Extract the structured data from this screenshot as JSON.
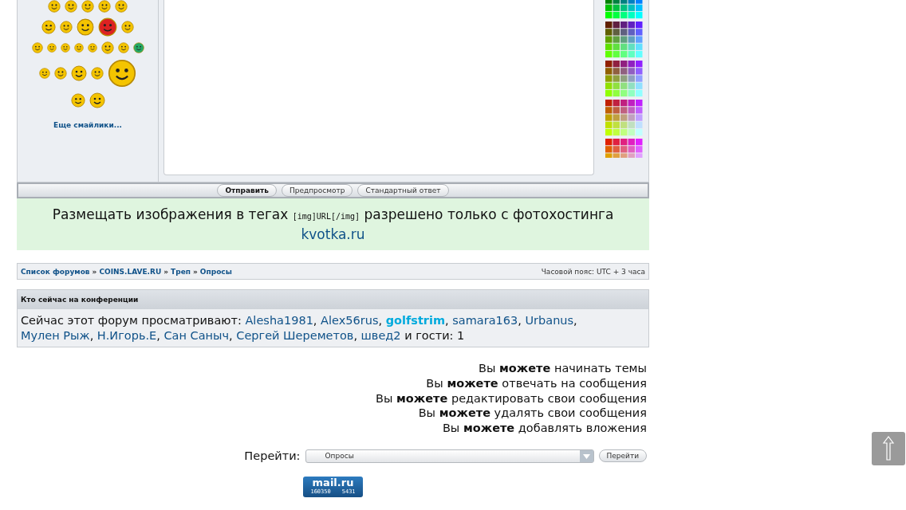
{
  "smilies": {
    "more_link": "Еще смайлики..."
  },
  "post_buttons": [
    {
      "label": "Отправить",
      "kind": "primary"
    },
    {
      "label": "Предпросмотр",
      "kind": "normal"
    },
    {
      "label": "Стандартный ответ",
      "kind": "normal"
    }
  ],
  "notice": {
    "text_before": "Размещать изображения в тегах ",
    "code": "[img]URL[/img]",
    "text_after": " разрешено только с фотохостинга",
    "link": "kvotka.ru"
  },
  "breadcrumb": [
    {
      "kind": "link",
      "label": "Список форумов"
    },
    {
      "kind": "separator",
      "label": "»"
    },
    {
      "kind": "link",
      "label": "COINS.LAVE.RU"
    },
    {
      "kind": "separator",
      "label": "»"
    },
    {
      "kind": "link",
      "label": "Треп"
    },
    {
      "kind": "separator",
      "label": "»"
    },
    {
      "kind": "link",
      "label": "Опросы"
    }
  ],
  "timezone": "Часовой пояс: UTC + 3 часа",
  "online": {
    "title": "Кто сейчас на конференции",
    "intro": "Сейчас этот форум просматривают: ",
    "users": [
      {
        "name": "Alesha1981",
        "color": "#105289",
        "bold": false
      },
      {
        "name": "Alex56rus",
        "color": "#105289",
        "bold": false
      },
      {
        "name": "golfstrim",
        "color": "#00aadd",
        "bold": true
      },
      {
        "name": "samara163",
        "color": "#105289",
        "bold": false
      },
      {
        "name": "Urbanus",
        "color": "#105289",
        "bold": false
      },
      {
        "name": "Мулен Рыж",
        "color": "#105289",
        "bold": false
      },
      {
        "name": "Н.Игорь.Е",
        "color": "#105289",
        "bold": false
      },
      {
        "name": "Сан Саныч",
        "color": "#105289",
        "bold": false
      },
      {
        "name": "Сергей Шереметов",
        "color": "#105289",
        "bold": false
      },
      {
        "name": "швед2",
        "color": "#105289",
        "bold": false
      }
    ],
    "separator": ", ",
    "guests": " и гости: 1"
  },
  "permissions": [
    "Вы **можете** начинать темы",
    "Вы **можете** отвечать на сообщения",
    "Вы **можете** редактировать свои сообщения",
    "Вы **можете** удалять свои сообщения",
    "Вы **можете** добавлять вложения"
  ],
  "jump": {
    "label": "Перейти:",
    "value": "Опросы",
    "button": "Перейти"
  },
  "counter": {
    "logo": "mail.ru",
    "visits": "160350",
    "hosts": "5431"
  }
}
